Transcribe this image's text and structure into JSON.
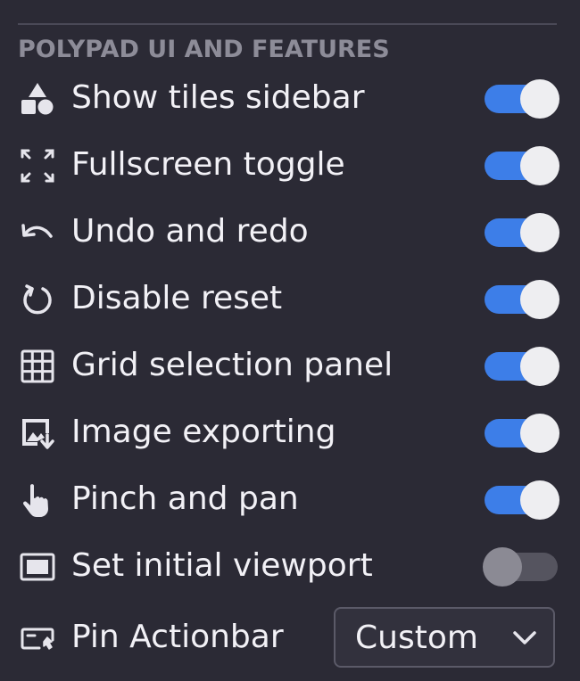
{
  "section": {
    "title": "POLYPAD UI AND FEATURES"
  },
  "colors": {
    "background": "#2b2a35",
    "toggle_on": "#3d7ee8",
    "toggle_off": "#55545f",
    "knob_on": "#eeeef1",
    "knob_off": "#8b8a94",
    "icon": "#e6e5ec"
  },
  "settings": [
    {
      "label": "Show tiles sidebar",
      "icon": "shapes-icon",
      "enabled": true
    },
    {
      "label": "Fullscreen toggle",
      "icon": "fullscreen-icon",
      "enabled": true
    },
    {
      "label": "Undo and redo",
      "icon": "undo-icon",
      "enabled": true
    },
    {
      "label": "Disable reset",
      "icon": "reset-icon",
      "enabled": true
    },
    {
      "label": "Grid selection panel",
      "icon": "grid-icon",
      "enabled": true
    },
    {
      "label": "Image exporting",
      "icon": "image-export-icon",
      "enabled": true
    },
    {
      "label": "Pinch and pan",
      "icon": "hand-pointer-icon",
      "enabled": true
    },
    {
      "label": "Set initial viewport",
      "icon": "viewport-icon",
      "enabled": false
    }
  ],
  "pin_actionbar": {
    "label": "Pin Actionbar",
    "icon": "actionbar-icon",
    "selected": "Custom"
  }
}
